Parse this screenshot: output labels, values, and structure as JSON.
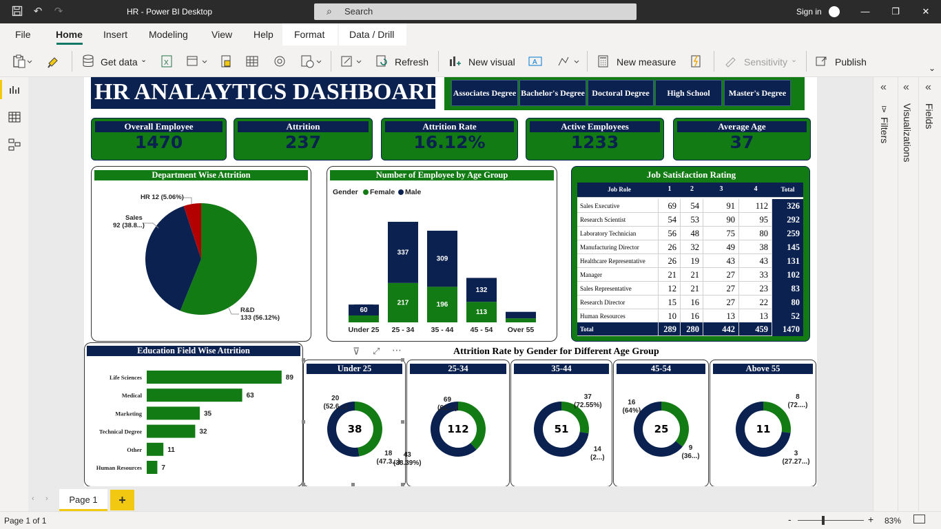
{
  "app": {
    "title": "HR - Power BI Desktop",
    "search_placeholder": "Search",
    "sign_in": "Sign in"
  },
  "menu": [
    "File",
    "Home",
    "Insert",
    "Modeling",
    "View",
    "Help",
    "Format",
    "Data / Drill"
  ],
  "ribbon": {
    "get_data": "Get data",
    "refresh": "Refresh",
    "new_visual": "New visual",
    "new_measure": "New measure",
    "sensitivity": "Sensitivity",
    "publish": "Publish"
  },
  "panes": {
    "filters": "Filters",
    "visualizations": "Visualizations",
    "fields": "Fields"
  },
  "page_tab": "Page 1",
  "status": {
    "page": "Page 1 of 1",
    "zoom": "83%"
  },
  "dashboard": {
    "title": "HR ANALAYTICS DASHBOARD",
    "slicers": [
      {
        "label": "Associates Degree"
      },
      {
        "label": "Bachelor's Degree"
      },
      {
        "label": "Doctoral Degree"
      },
      {
        "label": "High School"
      },
      {
        "label": "Master's Degree"
      }
    ],
    "kpis": [
      {
        "title": "Overall Employee",
        "value": "1470"
      },
      {
        "title": "Attrition",
        "value": "237"
      },
      {
        "title": "Attrition Rate",
        "value": "16.12%"
      },
      {
        "title": "Active Employees",
        "value": "1233"
      },
      {
        "title": "Average Age",
        "value": "37"
      }
    ],
    "colors": {
      "navy": "#0b2150",
      "green": "#137b13",
      "red": "#b30000"
    },
    "dept": {
      "title": "Department Wise Attrition",
      "labels": {
        "hr": "HR 12 (5.06%)",
        "sales_1": "Sales",
        "sales_2": "92 (38.8...)",
        "rd_1": "R&D",
        "rd_2": "133 (56.12%)"
      }
    },
    "age": {
      "title": "Number of Employee by Age Group",
      "legend_title": "Gender",
      "legend_female": "Female",
      "legend_male": "Male"
    },
    "job": {
      "title": "Job Satisfaction Rating",
      "headers": [
        "Job Role",
        "1",
        "2",
        "3",
        "4",
        "Total"
      ],
      "rows": [
        {
          "role": "Sales Executive",
          "v": [
            "69",
            "54",
            "91",
            "112"
          ],
          "total": "326"
        },
        {
          "role": "Research Scientist",
          "v": [
            "54",
            "53",
            "90",
            "95"
          ],
          "total": "292"
        },
        {
          "role": "Laboratory Technician",
          "v": [
            "56",
            "48",
            "75",
            "80"
          ],
          "total": "259"
        },
        {
          "role": "Manufacturing Director",
          "v": [
            "26",
            "32",
            "49",
            "38"
          ],
          "total": "145"
        },
        {
          "role": "Healthcare Representative",
          "v": [
            "26",
            "19",
            "43",
            "43"
          ],
          "total": "131"
        },
        {
          "role": "Manager",
          "v": [
            "21",
            "21",
            "27",
            "33"
          ],
          "total": "102"
        },
        {
          "role": "Sales Representative",
          "v": [
            "12",
            "21",
            "27",
            "23"
          ],
          "total": "83"
        },
        {
          "role": "Research Director",
          "v": [
            "15",
            "16",
            "27",
            "22"
          ],
          "total": "80"
        },
        {
          "role": "Human Resources",
          "v": [
            "10",
            "16",
            "13",
            "13"
          ],
          "total": "52"
        }
      ],
      "total_row": {
        "role": "Total",
        "v": [
          "289",
          "280",
          "442",
          "459"
        ],
        "total": "1470"
      }
    },
    "edu": {
      "title": "Education Field Wise Attrition"
    },
    "donuts_title": "Attrition Rate by Gender for Different Age Group",
    "donuts": [
      {
        "title": "Under 25",
        "center": "38",
        "male_1": "20",
        "male_2": "(52.6...)",
        "female_1": "18",
        "female_2": "(47.3...)",
        "female_frac": 0.4737
      },
      {
        "title": "25-34",
        "center": "112",
        "male_1": "69",
        "male_2": "(61....)",
        "female_1": "43",
        "female_2": "(38.39%)",
        "female_frac": 0.3839
      },
      {
        "title": "35-44",
        "center": "51",
        "male_1": "37",
        "male_2": "(72.55%)",
        "female_1": "14",
        "female_2": "(2...)",
        "female_frac": 0.2745
      },
      {
        "title": "45-54",
        "center": "25",
        "male_1": "16",
        "male_2": "(64%)",
        "female_1": "9",
        "female_2": "(36...)",
        "female_frac": 0.36
      },
      {
        "title": "Above 55",
        "center": "11",
        "male_1": "8",
        "male_2": "(72....)",
        "female_1": "3",
        "female_2": "(27.27...)",
        "female_frac": 0.2727
      }
    ]
  },
  "chart_data": [
    {
      "type": "pie",
      "title": "Department Wise Attrition",
      "categories": [
        "R&D",
        "Sales",
        "HR"
      ],
      "values": [
        133,
        92,
        12
      ]
    },
    {
      "type": "bar",
      "title": "Number of Employee by Age Group",
      "categories": [
        "Under 25",
        "25 - 34",
        "35 - 44",
        "45 - 54",
        "Over 55"
      ],
      "series": [
        {
          "name": "Female",
          "values": [
            38,
            217,
            196,
            113,
            22
          ]
        },
        {
          "name": "Male",
          "values": [
            60,
            337,
            309,
            132,
            36
          ]
        }
      ],
      "data_labels_female": [
        "",
        "217",
        "196",
        "113",
        ""
      ],
      "data_labels_male": [
        "60",
        "337",
        "309",
        "132",
        ""
      ]
    },
    {
      "type": "bar",
      "title": "Education Field Wise Attrition",
      "categories": [
        "Life Sciences",
        "Medical",
        "Marketing",
        "Technical Degree",
        "Other",
        "Human Resources"
      ],
      "values": [
        89,
        63,
        35,
        32,
        11,
        7
      ]
    }
  ]
}
